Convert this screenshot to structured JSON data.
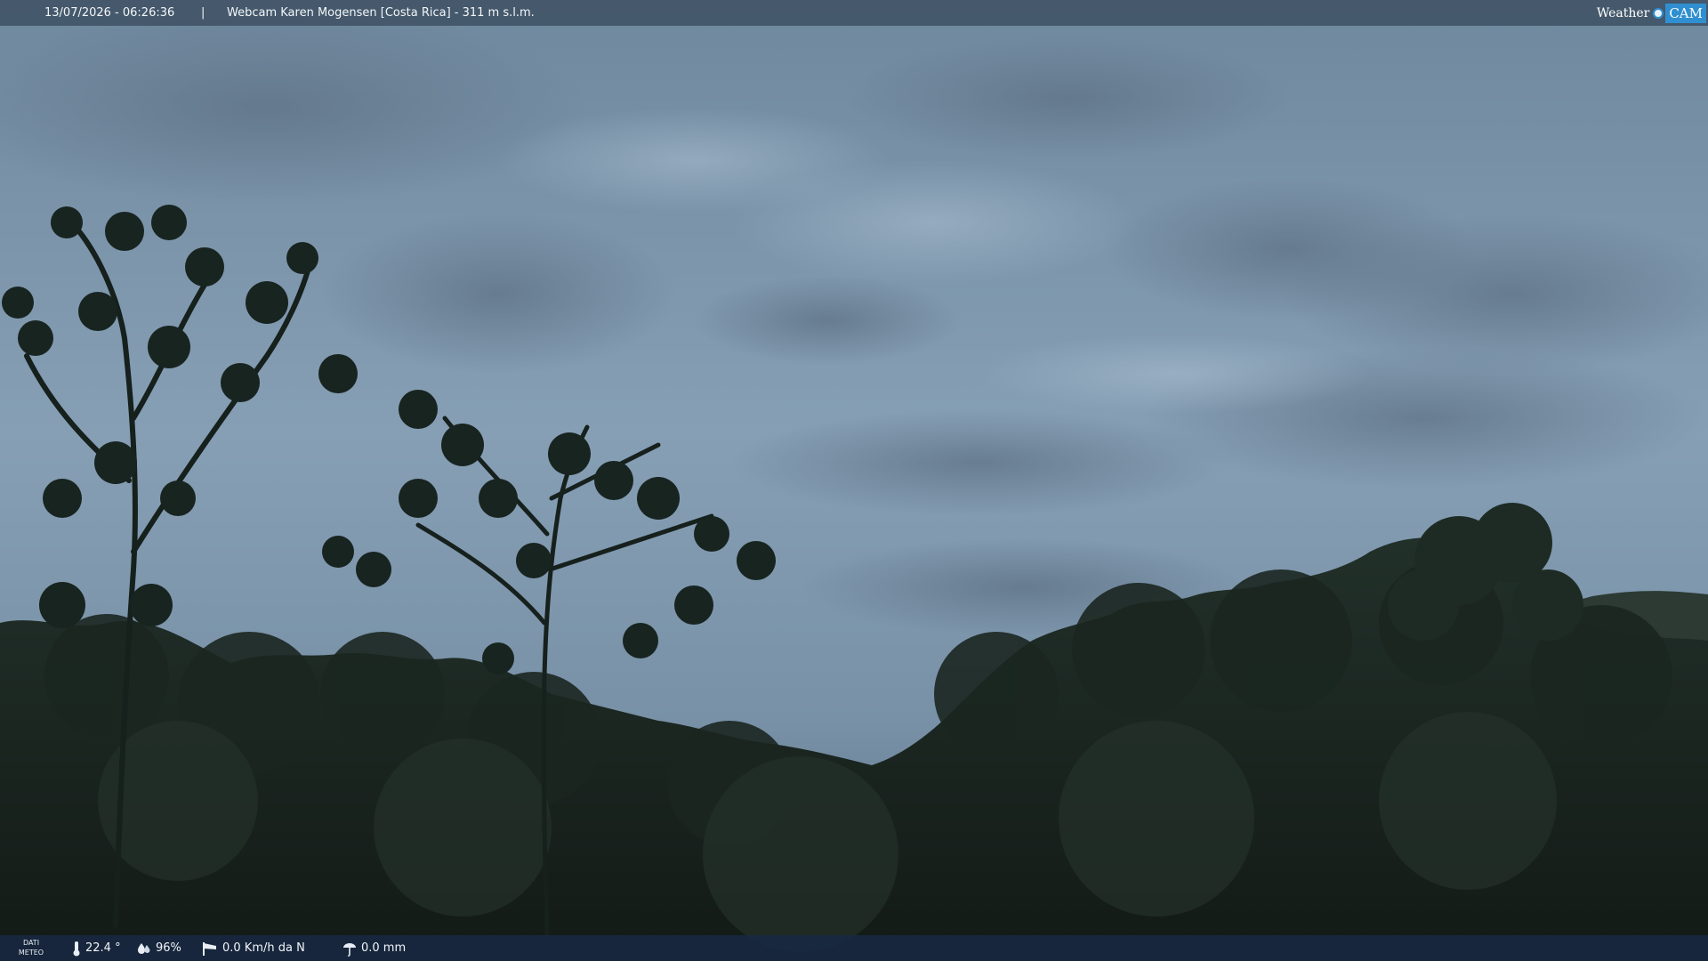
{
  "topbar": {
    "timestamp": "13/07/2026 - 06:26:36",
    "separator": "|",
    "title": "Webcam Karen Mogensen [Costa Rica]  - 311 m s.l.m."
  },
  "brand": {
    "weather": "Weather",
    "cam": "CAM"
  },
  "bottombar": {
    "dati_line1": "DATI",
    "dati_line2": "METEO",
    "temperature": "22.4 °",
    "humidity": "96%",
    "wind": "0.0 Km/h da N",
    "rain": "0.0 mm"
  },
  "icons": {
    "temperature": "thermometer-icon",
    "humidity": "water-drop-icon",
    "wind": "windsock-icon",
    "rain": "rain-gauge-icon"
  },
  "colors": {
    "sky_top": "#6e8aa3",
    "sky_mid": "#8ea9c0",
    "forest": "#1d2a22",
    "brand_blue": "#2f8fd0"
  }
}
